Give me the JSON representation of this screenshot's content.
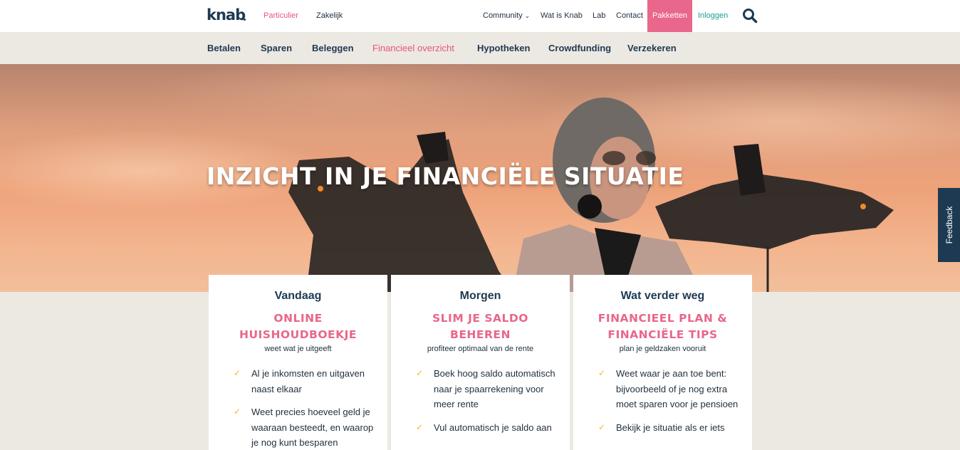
{
  "brand": {
    "logo": "knab"
  },
  "topbar": {
    "segments": [
      "Particulier",
      "Zakelijk"
    ],
    "links": {
      "community": "Community",
      "wat_is_knab": "Wat is Knab",
      "lab": "Lab",
      "contact": "Contact",
      "pakketten": "Pakketten",
      "inloggen": "Inloggen"
    },
    "search_icon": "search-icon"
  },
  "mainnav": {
    "items": [
      "Betalen",
      "Sparen",
      "Beleggen",
      "Financieel overzicht",
      "Hypotheken",
      "Crowdfunding",
      "Verzekeren"
    ],
    "active": "Financieel overzicht"
  },
  "hero": {
    "title": "INZICHT IN JE FINANCIËLE SITUATIE"
  },
  "feedback": {
    "label": "Feedback"
  },
  "cards": [
    {
      "when": "Vandaag",
      "title_lines": [
        "ONLINE",
        "HUISHOUDBOEKJE"
      ],
      "subtitle": "weet wat je uitgeeft",
      "bullets": [
        "Al je inkomsten en uitgaven naast elkaar",
        "Weet precies hoeveel geld je waaraan besteedt, en waarop je nog kunt besparen"
      ]
    },
    {
      "when": "Morgen",
      "title_lines": [
        "SLIM JE SALDO",
        "BEHEREN"
      ],
      "subtitle": "profiteer optimaal van de rente",
      "bullets": [
        "Boek hoog saldo automatisch naar je spaarrekening voor meer rente",
        "Vul automatisch je saldo aan"
      ]
    },
    {
      "when": "Wat verder weg",
      "title_lines": [
        "FINANCIEEL PLAN &",
        "FINANCIËLE TIPS"
      ],
      "subtitle": "plan je geldzaken vooruit",
      "bullets": [
        "Weet waar je aan toe bent: bijvoorbeeld of je nog extra moet sparen voor je pensioen",
        "Bekijk je situatie als er iets"
      ]
    }
  ],
  "colors": {
    "brand_pink": "#e8678a",
    "brand_navy": "#1d3a52",
    "brand_teal": "#1a9c93",
    "check": "#f2b824"
  }
}
